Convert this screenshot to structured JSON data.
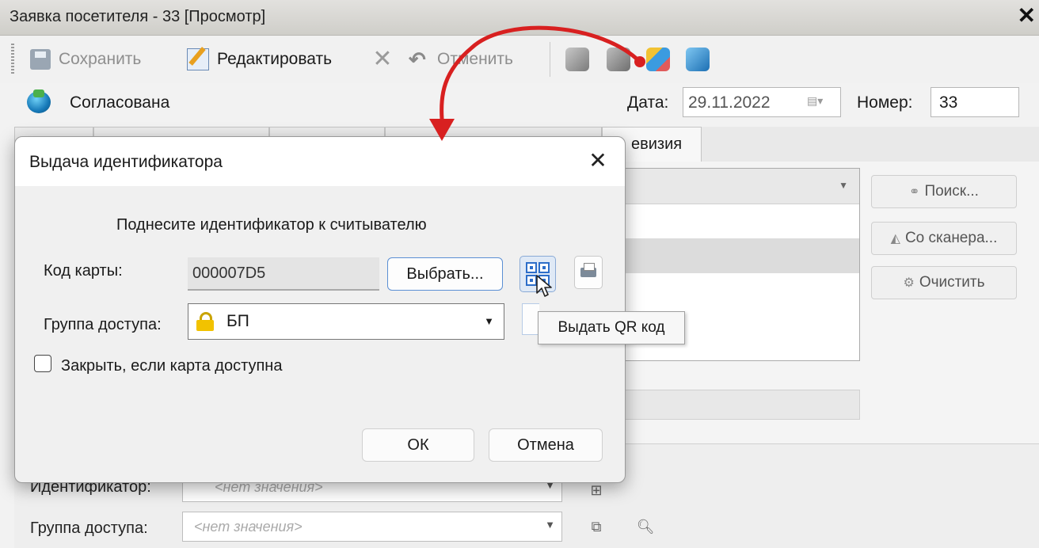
{
  "window": {
    "title": "Заявка посетителя - 33 [Просмотр]",
    "close_glyph": "✕"
  },
  "toolbar": {
    "save_label": "Сохранить",
    "edit_label": "Редактировать",
    "cancel_label": "Отменить"
  },
  "status": {
    "text": "Согласована"
  },
  "date": {
    "label": "Дата:",
    "value": "29.11.2022"
  },
  "number": {
    "label": "Номер:",
    "value": "33"
  },
  "tabs": {
    "revision_label": "евизия"
  },
  "side_buttons": {
    "search": "Поиск...",
    "scanner": "Со сканера...",
    "clear": "Очистить"
  },
  "bottom": {
    "identifier_label": "Идентификатор:",
    "identifier_placeholder": "<нет значения>",
    "group_label": "Группа доступа:",
    "group_placeholder": "<нет значения>"
  },
  "dialog": {
    "title": "Выдача идентификатора",
    "close_glyph": "✕",
    "prompt": "Поднесите идентификатор к считывателю",
    "card_label": "Код карты:",
    "card_value": "000007D5",
    "choose_label": "Выбрать...",
    "group_label": "Группа доступа:",
    "group_value": "БП",
    "tooltip": "Выдать QR код",
    "close_if_available_label": "Закрыть, если карта доступна",
    "close_if_available_checked": false,
    "ok_label": "ОК",
    "cancel_label": "Отмена"
  },
  "colors": {
    "annotation_arrow": "#d82020",
    "accent_blue": "#2d6ec9"
  },
  "icons": [
    "save-icon",
    "edit-icon",
    "x-icon",
    "undo-icon",
    "cube-icons",
    "qr-code-icon",
    "printer-icon",
    "lock-icon",
    "cursor-icon"
  ]
}
